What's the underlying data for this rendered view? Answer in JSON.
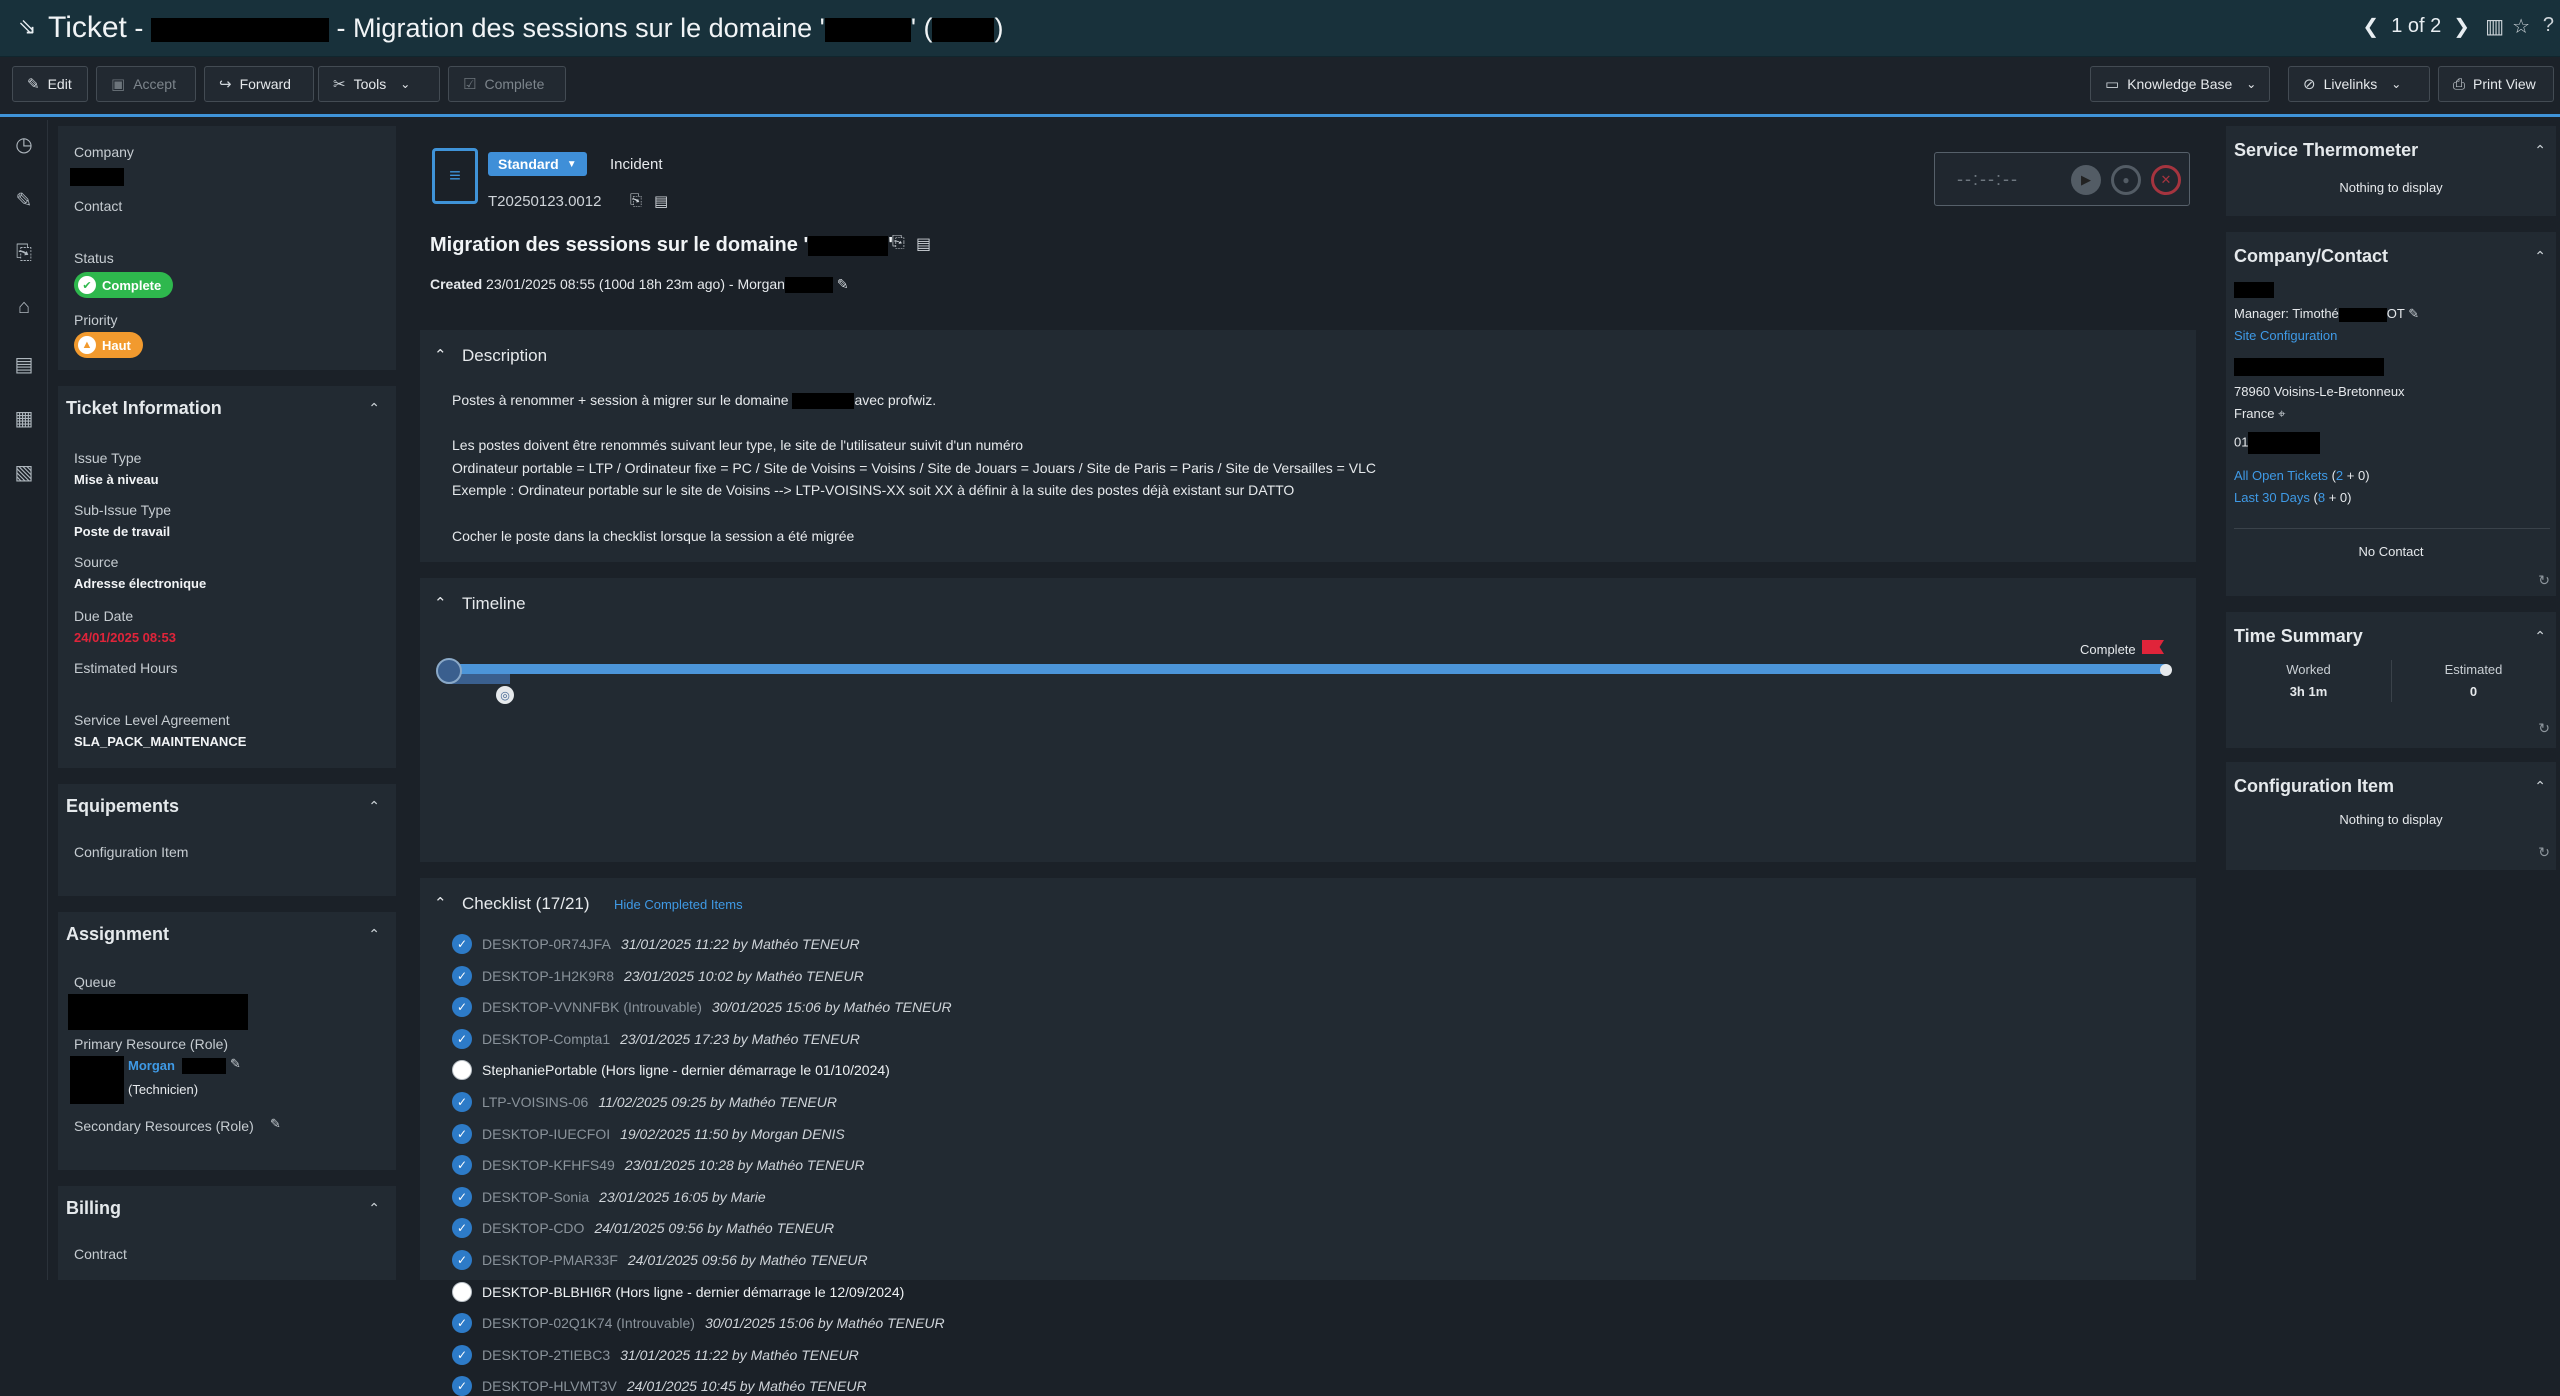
{
  "title": {
    "prefix": "Ticket",
    "dash": "-",
    "subject": "- Migration des sessions sur le domaine '",
    "paren_open": "' (",
    "paren_close": ")",
    "pager": "1 of 2"
  },
  "toolbar": {
    "edit": "Edit",
    "accept": "Accept",
    "forward": "Forward",
    "tools": "Tools",
    "complete": "Complete",
    "knowledge_base": "Knowledge Base",
    "livelinks": "Livelinks",
    "print_view": "Print View"
  },
  "left": {
    "company_label": "Company",
    "contact_label": "Contact",
    "status_label": "Status",
    "status_value": "Complete",
    "status_color": "#2eb84d",
    "priority_label": "Priority",
    "priority_value": "Haut",
    "priority_color": "#f29a2e",
    "ticket_info": {
      "header": "Ticket Information",
      "issue_type_label": "Issue Type",
      "issue_type": "Mise à niveau",
      "sub_issue_label": "Sub-Issue Type",
      "sub_issue": "Poste de travail",
      "source_label": "Source",
      "source": "Adresse électronique",
      "due_label": "Due Date",
      "due": "24/01/2025 08:53",
      "due_color": "#e0243a",
      "est_label": "Estimated Hours",
      "sla_label": "Service Level Agreement",
      "sla": "SLA_PACK_MAINTENANCE"
    },
    "equipements": {
      "header": "Equipements",
      "config_label": "Configuration Item"
    },
    "assignment": {
      "header": "Assignment",
      "queue_label": "Queue",
      "primary_label": "Primary Resource (Role)",
      "primary_name": "Morgan",
      "primary_role": "(Technicien)",
      "secondary_label": "Secondary Resources (Role)"
    },
    "billing": {
      "header": "Billing",
      "contract_label": "Contract"
    }
  },
  "ticket": {
    "category": "Standard",
    "type": "Incident",
    "number": "T20250123.0012",
    "timer": "--:--:--",
    "heading": "Migration des sessions sur le domaine '",
    "heading_close": "'",
    "created_label": "Created",
    "created_value": "23/01/2025 08:55 (100d 18h 23m ago)",
    "created_sep": "-",
    "created_by": "Morgan"
  },
  "description": {
    "header": "Description",
    "line1a": "Postes à renommer + session à migrer sur le domaine",
    "line1b": "avec profwiz.",
    "line2": "Les postes doivent être renommés suivant leur type, le site de l'utilisateur suivit d'un numéro",
    "line3": "Ordinateur portable = LTP / Ordinateur fixe = PC / Site de Voisins = Voisins / Site de Jouars = Jouars / Site de Paris = Paris / Site de Versailles = VLC",
    "line4": "Exemple : Ordinateur portable sur le site de Voisins --> LTP-VOISINS-XX soit XX à définir à la suite des postes déjà existant sur DATTO",
    "line5": "Cocher le poste dans la checklist lorsque la session a été migrée"
  },
  "timeline": {
    "header": "Timeline",
    "end_label": "Complete",
    "progress": 1.0
  },
  "checklist": {
    "header": "Checklist (17/21)",
    "hide_link": "Hide Completed Items",
    "items": [
      {
        "name": "DESKTOP-0R74JFA",
        "by": "31/01/2025 11:22 by Mathéo TENEUR",
        "done": true
      },
      {
        "name": "DESKTOP-1H2K9R8",
        "by": "23/01/2025 10:02 by Mathéo TENEUR",
        "done": true
      },
      {
        "name": "DESKTOP-VVNNFBK (Introuvable)",
        "by": "30/01/2025 15:06 by Mathéo TENEUR",
        "done": true
      },
      {
        "name": "DESKTOP-Compta1",
        "by": "23/01/2025 17:23 by Mathéo TENEUR",
        "done": true
      },
      {
        "name": "StephaniePortable (Hors ligne - dernier démarrage le 01/10/2024)",
        "by": "",
        "done": false
      },
      {
        "name": "LTP-VOISINS-06",
        "by": "11/02/2025 09:25 by Mathéo TENEUR",
        "done": true
      },
      {
        "name": "DESKTOP-IUECFOI",
        "by": "19/02/2025 11:50 by Morgan DENIS",
        "done": true
      },
      {
        "name": "DESKTOP-KFHFS49",
        "by": "23/01/2025 10:28 by Mathéo TENEUR",
        "done": true
      },
      {
        "name": "DESKTOP-Sonia",
        "by": "23/01/2025 16:05 by Marie",
        "done": true
      },
      {
        "name": "DESKTOP-CDO",
        "by": "24/01/2025 09:56 by Mathéo TENEUR",
        "done": true
      },
      {
        "name": "DESKTOP-PMAR33F",
        "by": "24/01/2025 09:56 by Mathéo TENEUR",
        "done": true
      },
      {
        "name": "DESKTOP-BLBHI6R (Hors ligne - dernier démarrage le 12/09/2024)",
        "by": "",
        "done": false
      },
      {
        "name": "DESKTOP-02Q1K74 (Introuvable)",
        "by": "30/01/2025 15:06 by Mathéo TENEUR",
        "done": true
      },
      {
        "name": "DESKTOP-2TIEBC3",
        "by": "31/01/2025 11:22 by Mathéo TENEUR",
        "done": true
      },
      {
        "name": "DESKTOP-HLVMT3V",
        "by": "24/01/2025 10:45 by Mathéo TENEUR",
        "done": true
      }
    ]
  },
  "right": {
    "thermo": {
      "header": "Service Thermometer",
      "empty": "Nothing to display"
    },
    "company": {
      "header": "Company/Contact",
      "manager": "Manager: Timothé",
      "manager_tail": "OT",
      "site_config": "Site Configuration",
      "city": "78960 Voisins-Le-Bretonneux",
      "country": "France",
      "phone_prefix": "01",
      "open_tickets_label": "All Open Tickets",
      "open_tickets_paren": "(",
      "open_tickets_count": "2",
      "open_tickets_tail": "+ 0)",
      "last30_label": "Last 30 Days",
      "last30_paren": "(",
      "last30_count": "8",
      "last30_tail": "+ 0)",
      "no_contact": "No Contact"
    },
    "time": {
      "header": "Time Summary",
      "worked_label": "Worked",
      "worked": "3h 1m",
      "est_label": "Estimated",
      "est": "0"
    },
    "config": {
      "header": "Configuration Item",
      "empty": "Nothing to display"
    }
  }
}
